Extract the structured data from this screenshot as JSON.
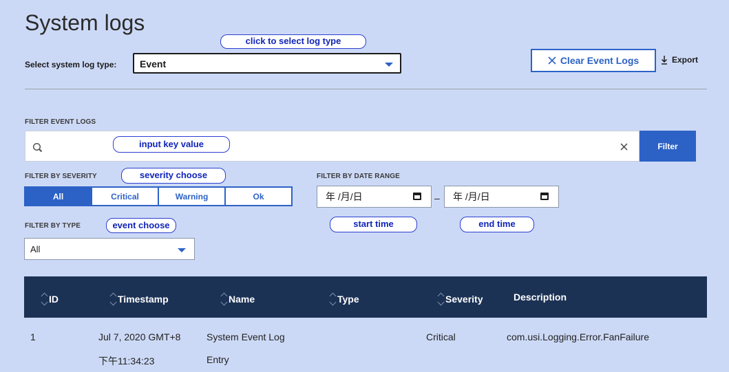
{
  "page": {
    "title": "System logs"
  },
  "log_type": {
    "label": "Select system log type:",
    "value": "Event"
  },
  "actions": {
    "clear_label": "Clear Event Logs",
    "export_label": "Export"
  },
  "search": {
    "section_label": "FILTER EVENT LOGS",
    "placeholder": "",
    "button_label": "Filter"
  },
  "severity": {
    "label": "FILTER BY SEVERITY",
    "options": [
      "All",
      "Critical",
      "Warning",
      "Ok"
    ],
    "selected": "All"
  },
  "date_range": {
    "label": "FILTER BY DATE RANGE",
    "start_value": "年 /月/日",
    "end_value": "年 /月/日",
    "separator": "–"
  },
  "type_filter": {
    "label": "FILTER BY TYPE",
    "value": "All"
  },
  "annotations": {
    "log_type": "click to select log type",
    "search": "input key value",
    "severity": "severity choose",
    "type": "event choose",
    "start": "start time",
    "end": "end time"
  },
  "table": {
    "columns": [
      "ID",
      "Timestamp",
      "Name",
      "Type",
      "Severity",
      "Description"
    ],
    "rows": [
      {
        "id": "1",
        "timestamp_line1": "Jul 7, 2020 GMT+8",
        "timestamp_line2": "下午11:34:23",
        "name_line1": "System Event Log",
        "name_line2": "Entry",
        "type": "",
        "severity": "Critical",
        "description": "com.usi.Logging.Error.FanFailure"
      }
    ]
  },
  "colors": {
    "background": "#ccd9f6",
    "accent": "#2c62c6",
    "table_header": "#1c3255",
    "annotation": "#1024b8"
  },
  "icons": {
    "search": "search-icon",
    "clear": "close-icon",
    "export": "download-icon",
    "calendar": "calendar-icon",
    "dropdown": "chevron-down-icon",
    "sort": "sort-icon"
  }
}
